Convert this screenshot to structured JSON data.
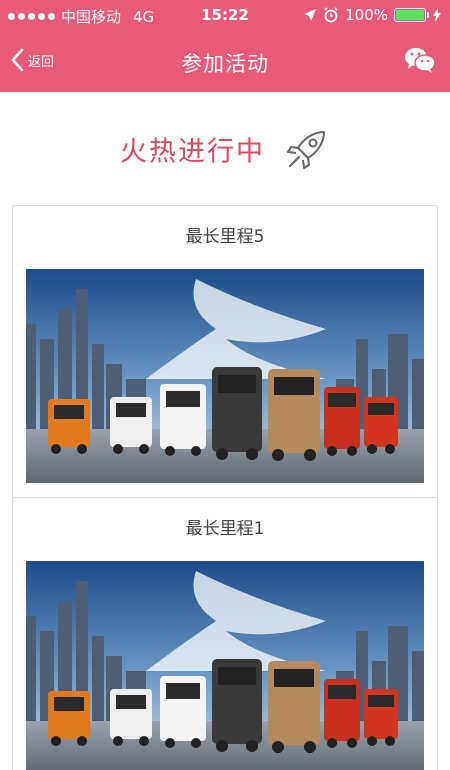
{
  "status_bar": {
    "carrier": "中国移动",
    "network": "4G",
    "time": "15:22",
    "battery": "100%",
    "battery_level": 1.0,
    "battery_color": "#5de05d"
  },
  "nav": {
    "back_label": "返回",
    "title": "参加活动",
    "background": "#e8597a",
    "share_icon": "wechat-icon"
  },
  "section": {
    "title": "火热进行中",
    "icon": "rocket-icon",
    "accent": "#e0485f"
  },
  "activities": [
    {
      "title": "最长里程5"
    },
    {
      "title": "最长里程1"
    }
  ]
}
